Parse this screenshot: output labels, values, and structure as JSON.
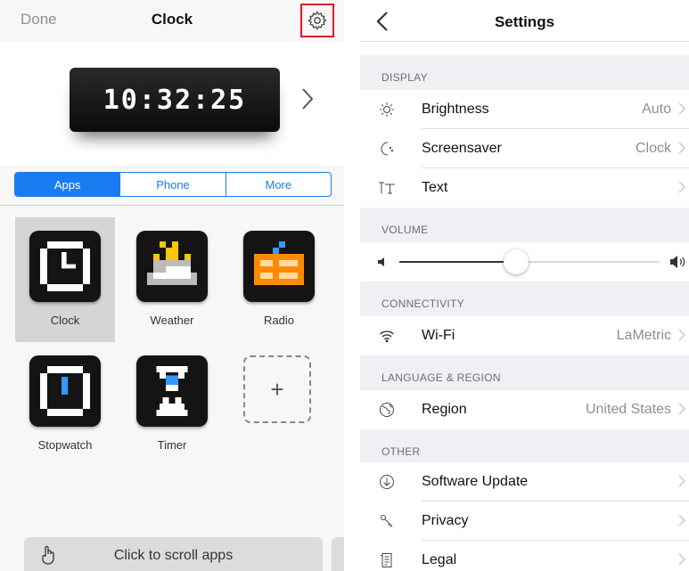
{
  "left": {
    "nav": {
      "done": "Done",
      "title": "Clock"
    },
    "device_time": "10:32:25",
    "segments": [
      "Apps",
      "Phone",
      "More"
    ],
    "apps": [
      {
        "label": "Clock",
        "icon": "clock-app-icon",
        "selected": true
      },
      {
        "label": "Weather",
        "icon": "weather-app-icon",
        "selected": false
      },
      {
        "label": "Radio",
        "icon": "radio-app-icon",
        "selected": false
      },
      {
        "label": "Stopwatch",
        "icon": "stopwatch-app-icon",
        "selected": false
      },
      {
        "label": "Timer",
        "icon": "timer-app-icon",
        "selected": false
      }
    ],
    "scroll_hint": "Click to scroll apps"
  },
  "right": {
    "nav": {
      "title": "Settings"
    },
    "sections": {
      "display": "DISPLAY",
      "volume": "VOLUME",
      "connectivity": "CONNECTIVITY",
      "language": "LANGUAGE & REGION",
      "other": "OTHER"
    },
    "rows": {
      "brightness": {
        "label": "Brightness",
        "value": "Auto"
      },
      "screensaver": {
        "label": "Screensaver",
        "value": "Clock"
      },
      "text": {
        "label": "Text",
        "value": ""
      },
      "wifi": {
        "label": "Wi-Fi",
        "value": "LaMetric"
      },
      "region": {
        "label": "Region",
        "value": "United States"
      },
      "software_update": {
        "label": "Software Update",
        "value": ""
      },
      "privacy": {
        "label": "Privacy",
        "value": ""
      },
      "legal": {
        "label": "Legal",
        "value": ""
      }
    },
    "volume_level": 0.45
  },
  "colors": {
    "accent": "#1a7cf0",
    "highlight": "#e0182d",
    "section_bg": "#efeff4"
  }
}
